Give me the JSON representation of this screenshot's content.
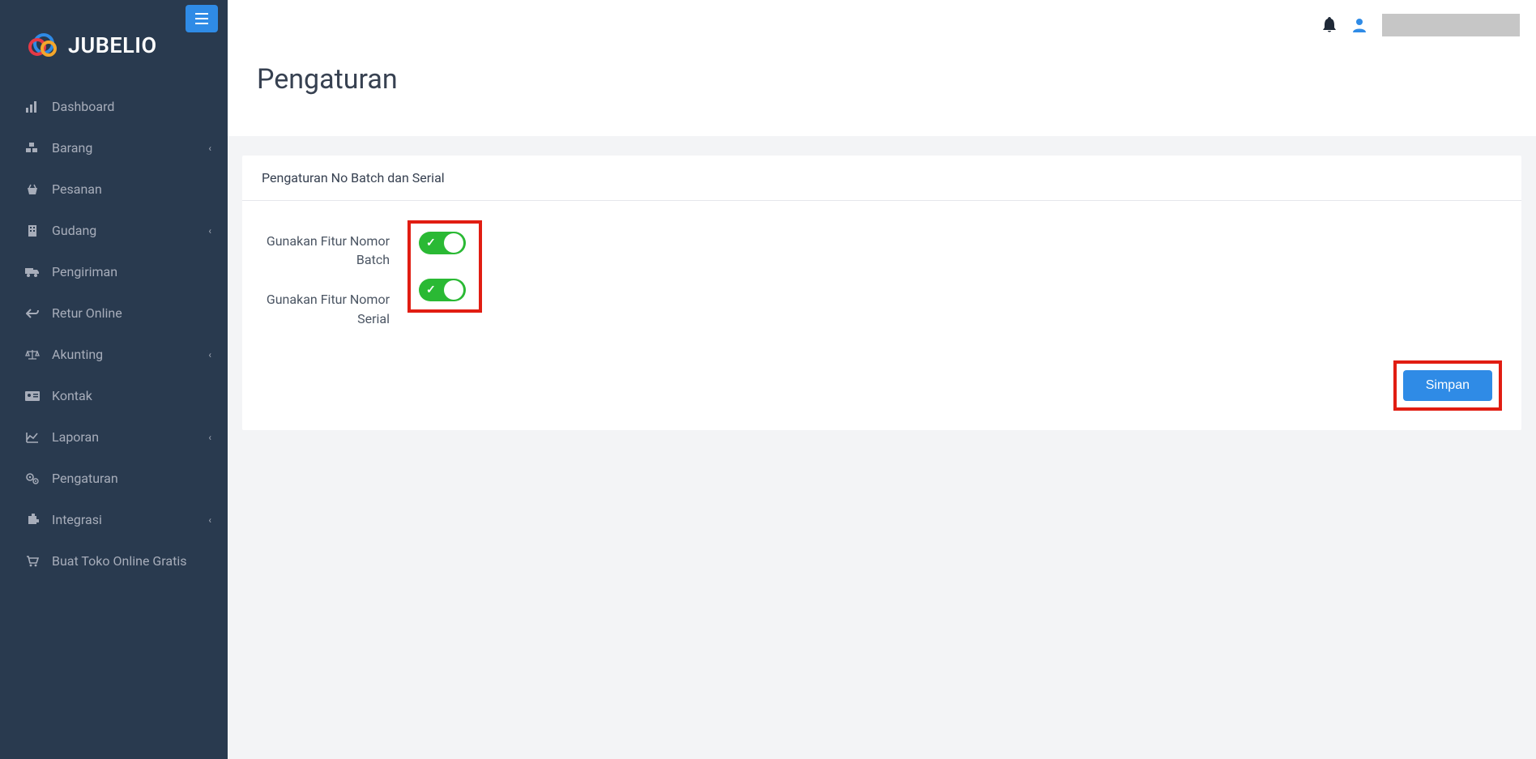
{
  "brand": {
    "name": "JUBELIO"
  },
  "sidebar": {
    "items": [
      {
        "label": "Dashboard",
        "expandable": false
      },
      {
        "label": "Barang",
        "expandable": true
      },
      {
        "label": "Pesanan",
        "expandable": false
      },
      {
        "label": "Gudang",
        "expandable": true
      },
      {
        "label": "Pengiriman",
        "expandable": false
      },
      {
        "label": "Retur Online",
        "expandable": false
      },
      {
        "label": "Akunting",
        "expandable": true
      },
      {
        "label": "Kontak",
        "expandable": false
      },
      {
        "label": "Laporan",
        "expandable": true
      },
      {
        "label": "Pengaturan",
        "expandable": false
      },
      {
        "label": "Integrasi",
        "expandable": true
      },
      {
        "label": "Buat Toko Online Gratis",
        "expandable": false
      }
    ]
  },
  "page": {
    "title": "Pengaturan"
  },
  "panel": {
    "title": "Pengaturan No Batch dan Serial",
    "settings": [
      {
        "label": "Gunakan Fitur Nomor Batch",
        "enabled": true
      },
      {
        "label": "Gunakan Fitur Nomor Serial",
        "enabled": true
      }
    ],
    "save_label": "Simpan"
  },
  "highlights": {
    "toggle_group": true,
    "save_button": true
  },
  "colors": {
    "sidebar_bg": "#293a4f",
    "primary": "#2f8be6",
    "toggle_on": "#2ab934",
    "highlight_border": "#e11d12"
  }
}
